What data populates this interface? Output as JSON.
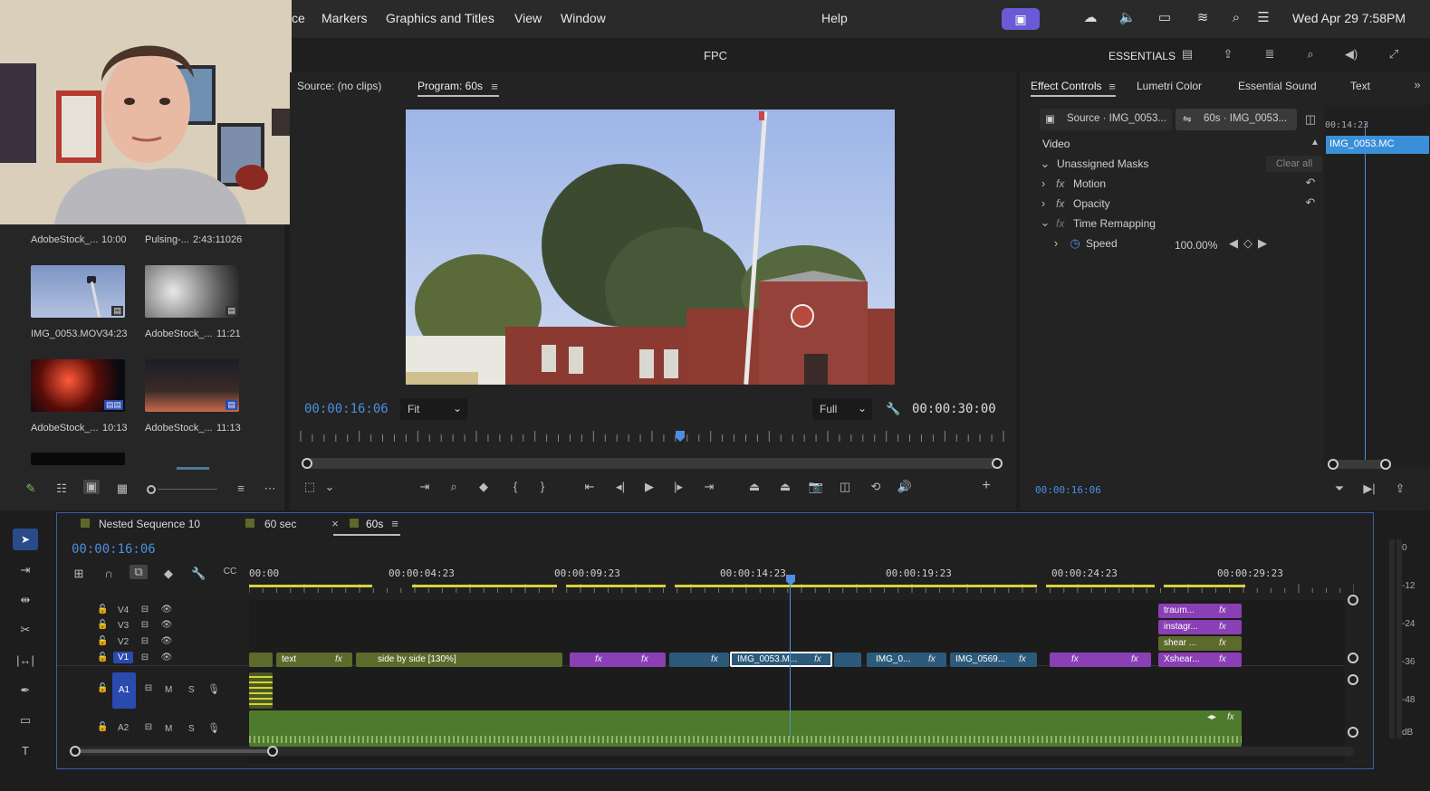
{
  "menubar": {
    "items": [
      "ce",
      "Markers",
      "Graphics and Titles",
      "View",
      "Window",
      "Help"
    ],
    "datetime": "Wed Apr 29  7:58PM"
  },
  "titlebar": {
    "title": "FPC",
    "workspace": "ESSENTIALS"
  },
  "project": {
    "top_labels": [
      {
        "name": "AdobeStock_...",
        "dur": "10:00"
      },
      {
        "name": "Pulsing-...",
        "dur": "2:43:11026"
      }
    ],
    "items": [
      {
        "name": "IMG_0053.MOV",
        "dur": "34:23"
      },
      {
        "name": "AdobeStock_...",
        "dur": "11:21"
      },
      {
        "name": "AdobeStock_...",
        "dur": "10:13"
      },
      {
        "name": "AdobeStock_...",
        "dur": "11:13"
      }
    ]
  },
  "program": {
    "source_tab": "Source: (no clips)",
    "program_tab": "Program: 60s",
    "timecode": "00:00:16:06",
    "fit": "Fit",
    "quality": "Full",
    "duration": "00:00:30:00",
    "playhead_fraction": 0.54
  },
  "effects": {
    "tabs": [
      "Effect Controls",
      "Lumetri Color",
      "Essential Sound",
      "Text"
    ],
    "source_btn": "Source · IMG_0053...",
    "seq_btn": "60s · IMG_0053...",
    "mini_tc": "00:14:23",
    "mini_clip": "IMG_0053.MC",
    "section": "Video",
    "masks": "Unassigned Masks",
    "clear_all": "Clear all",
    "rows": [
      "Motion",
      "Opacity",
      "Time Remapping"
    ],
    "speed_label": "Speed",
    "speed_value": "100.00%",
    "timecode": "00:00:16:06"
  },
  "timeline": {
    "tabs": [
      "Nested Sequence 10",
      "60 sec",
      "60s"
    ],
    "timecode": "00:00:16:06",
    "ruler": [
      "00:00",
      "00:00:04:23",
      "00:00:09:23",
      "00:00:14:23",
      "00:00:19:23",
      "00:00:24:23",
      "00:00:29:23"
    ],
    "tracks": {
      "v4": "V4",
      "v3": "V3",
      "v2": "V2",
      "v1": "V1",
      "a1": "A1",
      "a2": "A2",
      "m": "M",
      "s": "S"
    },
    "clips": {
      "text": "text",
      "side": "side by side [130%]",
      "img53": "IMG_0053.M...",
      "img0": "IMG_0...",
      "img569": "IMG_0569...",
      "xshear": "Xshear...",
      "traum": "traum...",
      "instagr": "instagr...",
      "shear": "shear ..."
    },
    "fx": "fx"
  },
  "meters": {
    "labels": [
      "0",
      "-12",
      "-24",
      "-36",
      "-48",
      "dB"
    ]
  },
  "colors": {
    "accent": "#4a8fe0",
    "purple": "#8a3fb4",
    "teal": "#2c5a7a",
    "olive": "#5c6a2c",
    "green": "#4e7a2c",
    "yellow": "#d6d23c"
  }
}
